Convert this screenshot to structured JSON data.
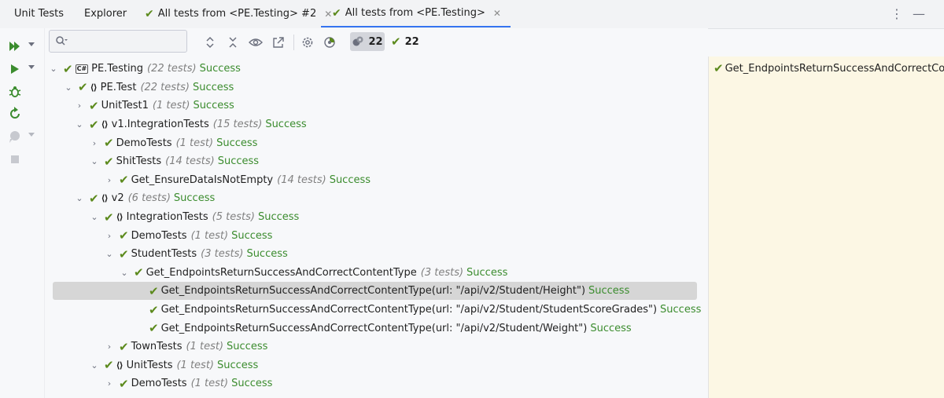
{
  "tabs": [
    {
      "label": "Unit Tests"
    },
    {
      "label": "Explorer"
    },
    {
      "label": "All tests from <PE.Testing> #2",
      "close": "✕"
    },
    {
      "label": "All tests from <PE.Testing>",
      "close": "✕"
    }
  ],
  "toolbar": {
    "search_placeholder": "",
    "passed_count_label": "22",
    "success_count_label": "22"
  },
  "tree": {
    "rows": [
      {
        "name": "PE.Testing",
        "count": "(22 tests)",
        "status": "Success"
      },
      {
        "name": "PE.Test",
        "count": "(22 tests)",
        "status": "Success"
      },
      {
        "name": "UnitTest1",
        "count": "(1 test)",
        "status": "Success"
      },
      {
        "name": "v1.IntegrationTests",
        "count": "(15 tests)",
        "status": "Success"
      },
      {
        "name": "DemoTests",
        "count": "(1 test)",
        "status": "Success"
      },
      {
        "name": "ShitTests",
        "count": "(14 tests)",
        "status": "Success"
      },
      {
        "name": "Get_EnsureDataIsNotEmpty",
        "count": "(14 tests)",
        "status": "Success"
      },
      {
        "name": "v2",
        "count": "(6 tests)",
        "status": "Success"
      },
      {
        "name": "IntegrationTests",
        "count": "(5 tests)",
        "status": "Success"
      },
      {
        "name": "DemoTests",
        "count": "(1 test)",
        "status": "Success"
      },
      {
        "name": "StudentTests",
        "count": "(3 tests)",
        "status": "Success"
      },
      {
        "name": "Get_EndpointsReturnSuccessAndCorrectContentType",
        "count": "(3 tests)",
        "status": "Success"
      },
      {
        "name": "Get_EndpointsReturnSuccessAndCorrectContentType(url: \"/api/v2/Student/Height\")",
        "count": "",
        "status": "Success"
      },
      {
        "name": "Get_EndpointsReturnSuccessAndCorrectContentType(url: \"/api/v2/Student/StudentScoreGrades\")",
        "count": "",
        "status": "Success"
      },
      {
        "name": "Get_EndpointsReturnSuccessAndCorrectContentType(url: \"/api/v2/Student/Weight\")",
        "count": "",
        "status": "Success"
      },
      {
        "name": "TownTests",
        "count": "(1 test)",
        "status": "Success"
      },
      {
        "name": "UnitTests",
        "count": "(1 test)",
        "status": "Success"
      },
      {
        "name": "DemoTests",
        "count": "(1 test)",
        "status": "Success"
      }
    ]
  },
  "details": {
    "title": "Get_EndpointsReturnSuccessAndCorrectContentType"
  },
  "colors": {
    "success_text": "#3b8c2e",
    "check": "#5c8a1d",
    "selection": "#d6d6d6",
    "details_bg": "#fcf7e4",
    "active_tab_underline": "#3574f0"
  }
}
